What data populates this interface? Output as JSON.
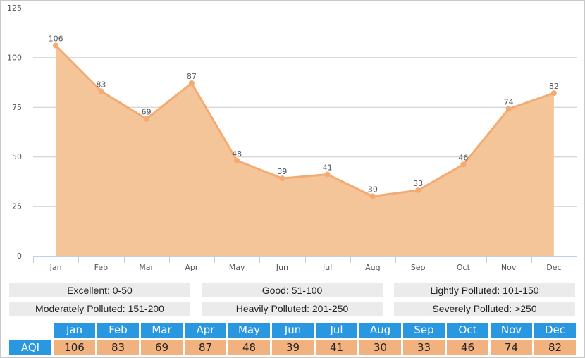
{
  "chart_data": {
    "type": "area",
    "title": "",
    "xlabel": "",
    "ylabel": "",
    "categories": [
      "Jan",
      "Feb",
      "Mar",
      "Apr",
      "May",
      "Jun",
      "Jul",
      "Aug",
      "Sep",
      "Oct",
      "Nov",
      "Dec"
    ],
    "series": [
      {
        "name": "AQI",
        "values": [
          106,
          83,
          69,
          87,
          48,
          39,
          41,
          30,
          33,
          46,
          74,
          82
        ]
      }
    ],
    "ylim": [
      0,
      125
    ],
    "yticks": [
      0,
      25,
      50,
      75,
      100,
      125
    ],
    "grid": true,
    "data_labels": true,
    "colors": {
      "fill": "#f5c59a",
      "line": "#f2ab72",
      "grid": "#c8c8c8",
      "axis": "#c0d0e0"
    }
  },
  "legend": [
    {
      "label": "Excellent: 0-50"
    },
    {
      "label": "Good: 51-100"
    },
    {
      "label": "Lightly Polluted: 101-150"
    },
    {
      "label": "Moderately Polluted: 151-200"
    },
    {
      "label": "Heavily Polluted: 201-250"
    },
    {
      "label": "Severely Polluted: >250"
    }
  ],
  "table": {
    "row_label": "AQI",
    "months": [
      "Jan",
      "Feb",
      "Mar",
      "Apr",
      "May",
      "Jun",
      "Jul",
      "Aug",
      "Sep",
      "Oct",
      "Nov",
      "Dec"
    ],
    "values": [
      "106",
      "83",
      "69",
      "87",
      "48",
      "39",
      "41",
      "30",
      "33",
      "46",
      "74",
      "82"
    ],
    "colors": {
      "header": "#2a98e0",
      "value": "#f2b27f"
    }
  }
}
